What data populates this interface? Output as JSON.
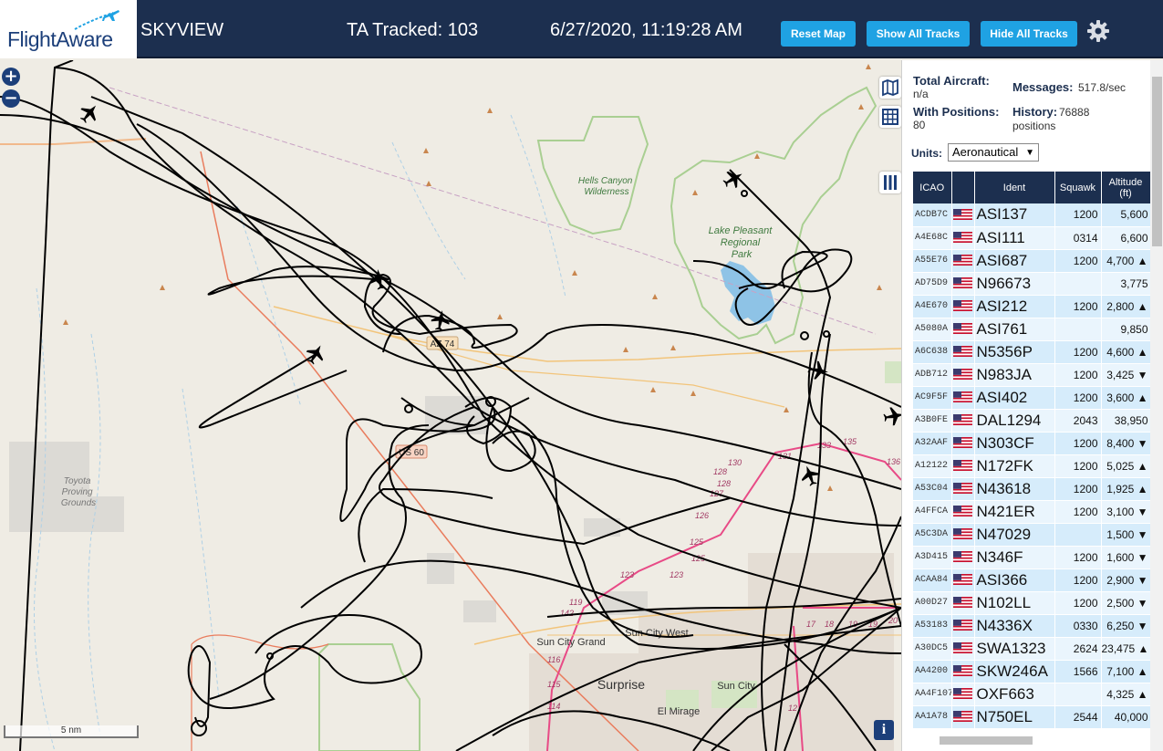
{
  "header": {
    "logo_text": "FlightAware",
    "app_name": "SKYVIEW",
    "tracked": "TA Tracked: 103",
    "datetime": "6/27/2020, 11:19:28 AM",
    "buttons": {
      "reset": "Reset Map",
      "show": "Show All Tracks",
      "hide": "Hide All Tracks"
    },
    "settings_icon": "gear-icon"
  },
  "map": {
    "zoom_in": "+",
    "zoom_out": "−",
    "scale": "5 nm",
    "info": "i",
    "labels": {
      "hells_canyon": [
        "Hells Canyon",
        "Wilderness"
      ],
      "lake_pleasant": [
        "Lake Pleasant",
        "Regional",
        "Park"
      ],
      "toyota": [
        "Toyota",
        "Proving",
        "Grounds"
      ],
      "az74": "AZ 74",
      "us60": "US 60",
      "sun_city_west": "Sun City West",
      "sun_city_grand": "Sun City Grand",
      "surprise": "Surprise",
      "sun_city": "Sun City",
      "el_mirage": "El Mirage",
      "exits": [
        "119",
        "116",
        "115",
        "114",
        "123",
        "123",
        "125",
        "125",
        "126",
        "127",
        "128",
        "128",
        "130",
        "131",
        "133",
        "135",
        "136",
        "17",
        "18",
        "19",
        "19",
        "20",
        "12",
        "142"
      ]
    }
  },
  "sidebar": {
    "total_aircraft_label": "Total Aircraft:",
    "total_aircraft_value": "n/a",
    "with_positions_label": "With Positions:",
    "with_positions_value": "80",
    "messages_label": "Messages:",
    "messages_value": "517.8/sec",
    "history_label": "History:",
    "history_value": "76888",
    "history_unit": "positions",
    "units_label": "Units:",
    "units_value": "Aeronautical",
    "columns": [
      "ICAO",
      "",
      "Ident",
      "Squawk",
      "Altitude (ft)"
    ],
    "rows": [
      {
        "icao": "ACDB7C",
        "ident": "ASI137",
        "squawk": "1200",
        "alt": "5,600"
      },
      {
        "icao": "A4E68C",
        "ident": "ASI111",
        "squawk": "0314",
        "alt": "6,600"
      },
      {
        "icao": "A55E76",
        "ident": "ASI687",
        "squawk": "1200",
        "alt": "4,700 ▲"
      },
      {
        "icao": "AD75D9",
        "ident": "N96673",
        "squawk": "",
        "alt": "3,775"
      },
      {
        "icao": "A4E670",
        "ident": "ASI212",
        "squawk": "1200",
        "alt": "2,800 ▲"
      },
      {
        "icao": "A5080A",
        "ident": "ASI761",
        "squawk": "",
        "alt": "9,850"
      },
      {
        "icao": "A6C638",
        "ident": "N5356P",
        "squawk": "1200",
        "alt": "4,600 ▲"
      },
      {
        "icao": "ADB712",
        "ident": "N983JA",
        "squawk": "1200",
        "alt": "3,425 ▼"
      },
      {
        "icao": "AC9F5F",
        "ident": "ASI402",
        "squawk": "1200",
        "alt": "3,600 ▲"
      },
      {
        "icao": "A3B0FE",
        "ident": "DAL1294",
        "squawk": "2043",
        "alt": "38,950"
      },
      {
        "icao": "A32AAF",
        "ident": "N303CF",
        "squawk": "1200",
        "alt": "8,400 ▼"
      },
      {
        "icao": "A12122",
        "ident": "N172FK",
        "squawk": "1200",
        "alt": "5,025 ▲"
      },
      {
        "icao": "A53C04",
        "ident": "N43618",
        "squawk": "1200",
        "alt": "1,925 ▲"
      },
      {
        "icao": "A4FFCA",
        "ident": "N421ER",
        "squawk": "1200",
        "alt": "3,100 ▼"
      },
      {
        "icao": "A5C3DA",
        "ident": "N47029",
        "squawk": "",
        "alt": "1,500 ▼"
      },
      {
        "icao": "A3D415",
        "ident": "N346F",
        "squawk": "1200",
        "alt": "1,600 ▼"
      },
      {
        "icao": "ACAA84",
        "ident": "ASI366",
        "squawk": "1200",
        "alt": "2,900 ▼"
      },
      {
        "icao": "A00D27",
        "ident": "N102LL",
        "squawk": "1200",
        "alt": "2,500 ▼"
      },
      {
        "icao": "A53183",
        "ident": "N4336X",
        "squawk": "0330",
        "alt": "6,250 ▼"
      },
      {
        "icao": "A30DC5",
        "ident": "SWA1323",
        "squawk": "2624",
        "alt": "23,475 ▲"
      },
      {
        "icao": "AA4200",
        "ident": "SKW246A",
        "squawk": "1566",
        "alt": "7,100 ▲"
      },
      {
        "icao": "AA4F107",
        "ident": "OXF663",
        "squawk": "",
        "alt": "4,325 ▲"
      },
      {
        "icao": "AA1A78",
        "ident": "N750EL",
        "squawk": "2544",
        "alt": "40,000"
      }
    ]
  },
  "colors": {
    "header_bg": "#1c2f4f",
    "button_bg": "#1fa2e3",
    "map_bg": "#efece4",
    "row_a": "#d6ecfb",
    "row_b": "#eaf5fd"
  }
}
